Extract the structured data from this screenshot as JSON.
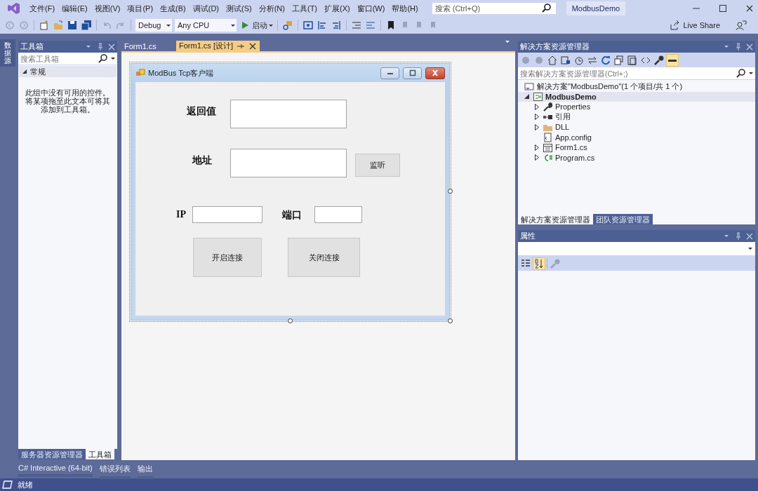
{
  "menu_bar": {
    "items": [
      "文件(F)",
      "编辑(E)",
      "视图(V)",
      "项目(P)",
      "生成(B)",
      "调试(D)",
      "测试(S)",
      "分析(N)",
      "工具(T)",
      "扩展(X)",
      "窗口(W)",
      "帮助(H)"
    ],
    "search": {
      "placeholder": "搜索 (Ctrl+Q)"
    },
    "solution_name": "ModbusDemo"
  },
  "toolbar": {
    "configuration": "Debug",
    "platform": "Any CPU",
    "start_button": "启动",
    "live_share": "Live Share"
  },
  "side_tab": "数据源",
  "toolbox": {
    "title": "工具箱",
    "search": {
      "placeholder": "搜索工具箱"
    },
    "group": {
      "label": "常规",
      "expanded": true
    },
    "empty_message": "此组中没有可用的控件。将某项拖至此文本可将其添加到工具箱。",
    "tabs": [
      {
        "label": "服务器资源管理器",
        "selected": false
      },
      {
        "label": "工具箱",
        "selected": true
      }
    ]
  },
  "document_tabs": [
    {
      "label": "Form1.cs",
      "selected": false
    },
    {
      "label": "Form1.cs [设计]",
      "selected": true
    }
  ],
  "form": {
    "title": "ModBus Tcp客户端",
    "return_value_label": "返回值",
    "address_label": "地址",
    "listen_button": "监听",
    "ip_label": "IP",
    "port_label": "端口",
    "connect_button": "开启连接",
    "disconnect_button": "关闭连接"
  },
  "solution_explorer": {
    "title": "解决方案资源管理器",
    "search": {
      "placeholder": "搜索解决方案资源管理器(Ctrl+;)"
    },
    "tree": [
      {
        "label": "解决方案\"ModbusDemo\"(1 个项目/共 1 个)",
        "kind": "solution",
        "selected": false,
        "children": [
          {
            "label": "ModbusDemo",
            "kind": "project",
            "expanded": true,
            "selected": true,
            "children": [
              {
                "label": "Properties",
                "kind": "properties",
                "expanded": false,
                "selected": false
              },
              {
                "label": "引用",
                "kind": "references",
                "expanded": false,
                "selected": false
              },
              {
                "label": "DLL",
                "kind": "folder",
                "expanded": false,
                "selected": false
              },
              {
                "label": "App.config",
                "kind": "config",
                "selected": false
              },
              {
                "label": "Form1.cs",
                "kind": "form",
                "expanded": false,
                "selected": false
              },
              {
                "label": "Program.cs",
                "kind": "csharp",
                "expanded": false,
                "selected": false
              }
            ]
          }
        ]
      }
    ],
    "tabs": [
      {
        "label": "解决方案资源管理器",
        "selected": true
      },
      {
        "label": "团队资源管理器",
        "selected": false
      }
    ]
  },
  "properties": {
    "title": "属性",
    "view_buttons": [
      {
        "kind": "categorized",
        "selected": false
      },
      {
        "kind": "alphabetical",
        "selected": true
      }
    ]
  },
  "bottom_tabs": [
    "C# Interactive (64-bit)",
    "错误列表",
    "输出"
  ],
  "status_bar": {
    "text": "就绪"
  }
}
